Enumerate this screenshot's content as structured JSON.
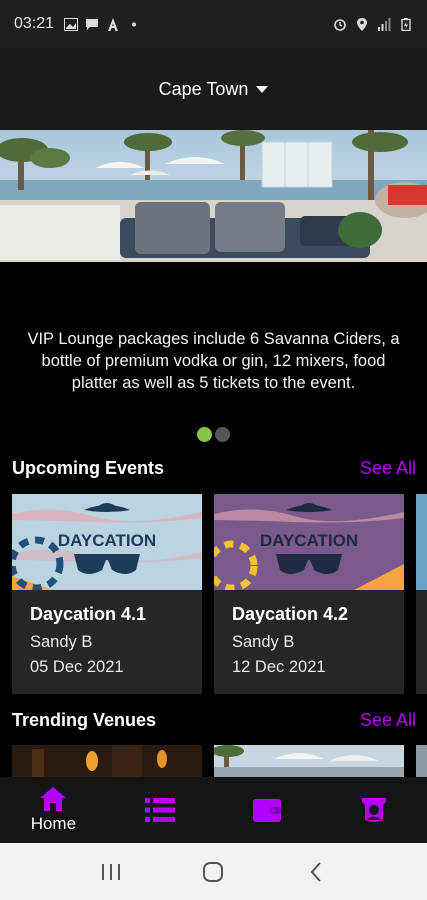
{
  "status": {
    "time": "03:21"
  },
  "header": {
    "city": "Cape Town"
  },
  "banner": {
    "text": "VIP Lounge packages include 6 Savanna Ciders, a bottle of premium vodka or gin, 12 mixers, food platter as well as 5 tickets to the event.",
    "slides": 2,
    "active_slide": 1
  },
  "upcoming": {
    "title": "Upcoming Events",
    "see_all": "See All",
    "events": [
      {
        "name": "Daycation 4.1",
        "host": "Sandy B",
        "date": "05 Dec 2021",
        "logo": "DAYCATION"
      },
      {
        "name": "Daycation 4.2",
        "host": "Sandy B",
        "date": "12 Dec 2021",
        "logo": "DAYCATION"
      }
    ]
  },
  "trending": {
    "title": "Trending Venues",
    "see_all": "See All"
  },
  "nav": {
    "items": [
      {
        "label": "Home",
        "icon": "home-icon",
        "active": true
      },
      {
        "label": "",
        "icon": "list-icon"
      },
      {
        "label": "",
        "icon": "wallet-icon"
      },
      {
        "label": "",
        "icon": "profile-icon"
      }
    ]
  },
  "colors": {
    "accent": "#b400ff",
    "dot_active": "#8bc34a"
  }
}
